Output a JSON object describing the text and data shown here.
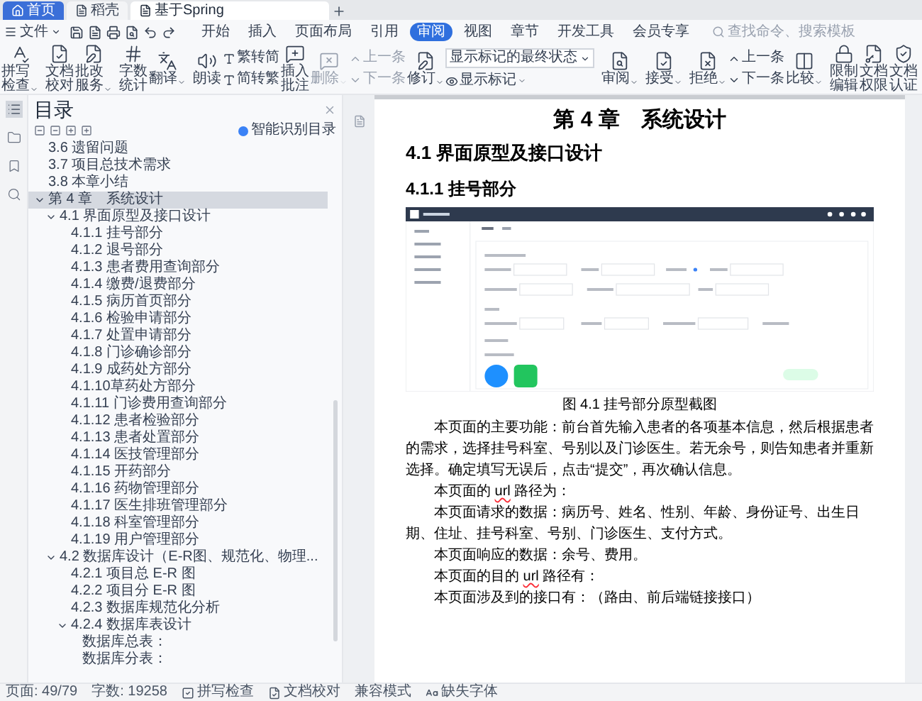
{
  "tab_strip": {
    "tabs": [
      {
        "label": "首页",
        "selected": false
      },
      {
        "label": "稻壳",
        "selected": false
      },
      {
        "label": "基于Spring",
        "selected": true
      }
    ]
  },
  "menu_bar": {
    "file_menu": "文件",
    "tabs": [
      {
        "label": "开始",
        "selected": false
      },
      {
        "label": "插入",
        "selected": false
      },
      {
        "label": "页面布局",
        "selected": false
      },
      {
        "label": "引用",
        "selected": false
      },
      {
        "label": "审阅",
        "selected": true
      },
      {
        "label": "视图",
        "selected": false
      },
      {
        "label": "章节",
        "selected": false
      },
      {
        "label": "开发工具",
        "selected": false
      },
      {
        "label": "会员专享",
        "selected": false
      }
    ],
    "search": {
      "placeholder": "查找命令、搜索模板"
    }
  },
  "ribbon": {
    "items": [
      {
        "kind": "large",
        "label": "拼写检查",
        "has_menu": true,
        "disabled": false
      },
      {
        "kind": "large",
        "label": "文档校对",
        "has_menu": false,
        "disabled": false
      },
      {
        "kind": "large",
        "label": "批改服务",
        "has_menu": true,
        "disabled": false
      },
      {
        "kind": "large",
        "label": "字数统计",
        "has_menu": false,
        "disabled": false
      },
      {
        "kind": "large",
        "label": "翻译",
        "has_menu": true,
        "disabled": false
      },
      {
        "kind": "large",
        "label": "朗读",
        "has_menu": false,
        "disabled": false
      },
      {
        "kind": "pair",
        "labels": [
          "繁转简",
          "简转繁"
        ],
        "disabled": false
      },
      {
        "kind": "large",
        "label": "插入批注",
        "has_menu": false,
        "disabled": false
      },
      {
        "kind": "large",
        "label": "删除",
        "has_menu": true,
        "disabled": true
      },
      {
        "kind": "pair",
        "labels": [
          "上一条",
          "下一条"
        ],
        "disabled": true
      },
      {
        "kind": "large",
        "label": "修订",
        "has_menu": true,
        "disabled": false
      },
      {
        "kind": "select",
        "value": "显示标记的最终状态",
        "sub_label": "显示标记",
        "has_menu": true,
        "disabled": false
      },
      {
        "kind": "large",
        "label": "审阅",
        "has_menu": true,
        "disabled": false
      },
      {
        "kind": "large",
        "label": "接受",
        "has_menu": true,
        "disabled": false
      },
      {
        "kind": "large",
        "label": "拒绝",
        "has_menu": true,
        "disabled": false
      },
      {
        "kind": "pair",
        "labels": [
          "上一条",
          "下一条"
        ],
        "disabled": false
      },
      {
        "kind": "large",
        "label": "比较",
        "has_menu": true,
        "disabled": false
      },
      {
        "kind": "large",
        "label": "限制编辑",
        "has_menu": false,
        "disabled": false
      },
      {
        "kind": "large",
        "label": "文档权限",
        "has_menu": false,
        "disabled": false
      },
      {
        "kind": "large",
        "label": "文档认证",
        "has_menu": false,
        "disabled": false
      }
    ]
  },
  "side_rail": {
    "items": [
      {
        "selected": true
      },
      {
        "selected": false
      },
      {
        "selected": false
      },
      {
        "selected": false
      }
    ]
  },
  "toc_panel": {
    "title": "目录",
    "smart_button": "智能识别目录",
    "items": [
      {
        "label": "3.6 遗留问题",
        "selected": false
      },
      {
        "label": "3.7 项目总技术需求",
        "selected": false
      },
      {
        "label": "3.8 本章小结",
        "selected": false
      },
      {
        "label": "第 4 章　系统设计",
        "selected": true,
        "expanded": true,
        "children": [
          {
            "label": "4.1 界面原型及接口设计",
            "selected": false,
            "expanded": true,
            "children": [
              {
                "label": "4.1.1 挂号部分",
                "selected": false
              },
              {
                "label": "4.1.2 退号部分",
                "selected": false
              },
              {
                "label": "4.1.3 患者费用查询部分",
                "selected": false
              },
              {
                "label": "4.1.4 缴费/退费部分",
                "selected": false
              },
              {
                "label": "4.1.5 病历首页部分",
                "selected": false
              },
              {
                "label": "4.1.6 检验申请部分",
                "selected": false
              },
              {
                "label": "4.1.7 处置申请部分",
                "selected": false
              },
              {
                "label": "4.1.8 门诊确诊部分",
                "selected": false
              },
              {
                "label": "4.1.9 成药处方部分",
                "selected": false
              },
              {
                "label": "4.1.10草药处方部分",
                "selected": false
              },
              {
                "label": "4.1.11 门诊费用查询部分",
                "selected": false
              },
              {
                "label": "4.1.12 患者检验部分",
                "selected": false
              },
              {
                "label": "4.1.13 患者处置部分",
                "selected": false
              },
              {
                "label": "4.1.14 医技管理部分",
                "selected": false
              },
              {
                "label": "4.1.15 开药部分",
                "selected": false
              },
              {
                "label": "4.1.16 药物管理部分",
                "selected": false
              },
              {
                "label": "4.1.17 医生排班管理部分",
                "selected": false
              },
              {
                "label": "4.1.18 科室管理部分",
                "selected": false
              },
              {
                "label": "4.1.19 用户管理部分",
                "selected": false
              }
            ]
          },
          {
            "label": "4.2 数据库设计（E-R图、规范化、物理...",
            "selected": false,
            "expanded": true,
            "children": [
              {
                "label": "4.2.1 项目总 E-R 图",
                "selected": false
              },
              {
                "label": "4.2.2 项目分 E-R 图",
                "selected": false
              },
              {
                "label": "4.2.3 数据库规范化分析",
                "selected": false
              },
              {
                "label": "4.2.4 数据库表设计",
                "selected": false,
                "expanded": true,
                "children": [
                  {
                    "label": "数据库总表：",
                    "selected": false
                  },
                  {
                    "label": "数据库分表：",
                    "selected": false
                  }
                ]
              }
            ]
          }
        ]
      }
    ]
  },
  "document": {
    "chapter_title": "第 4 章　系统设计",
    "section_title": "4.1 界面原型及接口设计",
    "subsection_title": "4.1.1 挂号部分",
    "figure_caption": "图 4.1 挂号部分原型截图",
    "paragraphs": [
      {
        "runs": [
          {
            "text": "本页面的主要功能：前台首先输入患者的各项基本信息，然后根据患者的需求，选择挂号科室、号别以及门诊医生。若无余号，则告知患者并重新选择。确定填写无误后，点击“提交”，再次确认信息。",
            "spelling_error": false
          }
        ]
      },
      {
        "runs": [
          {
            "text": "本页面的 ",
            "spelling_error": false
          },
          {
            "text": "url",
            "spelling_error": true
          },
          {
            "text": " 路径为：",
            "spelling_error": false
          }
        ]
      },
      {
        "runs": [
          {
            "text": "本页面请求的数据：病历号、姓名、性别、年龄、身份证号、出生日期、住址、挂号科室、号别、门诊医生、支付方式。",
            "spelling_error": false
          }
        ]
      },
      {
        "runs": [
          {
            "text": "本页面响应的数据：余号、费用。",
            "spelling_error": false
          }
        ]
      },
      {
        "runs": [
          {
            "text": "本页面的目的 ",
            "spelling_error": false
          },
          {
            "text": "url",
            "spelling_error": true
          },
          {
            "text": " 路径有：",
            "spelling_error": false
          }
        ]
      },
      {
        "runs": [
          {
            "text": "本页面涉及到的接口有：（路由、前后端链接接口）",
            "spelling_error": false
          }
        ]
      }
    ]
  },
  "status_bar": {
    "items": [
      {
        "kind": "text",
        "label": "页面: 49/79"
      },
      {
        "kind": "text",
        "label": "字数: 19258"
      },
      {
        "kind": "spell",
        "label": "拼写检查"
      },
      {
        "kind": "proof",
        "label": "文档校对"
      },
      {
        "kind": "text",
        "label": "兼容模式"
      },
      {
        "kind": "font",
        "label": "缺失字体"
      }
    ]
  }
}
